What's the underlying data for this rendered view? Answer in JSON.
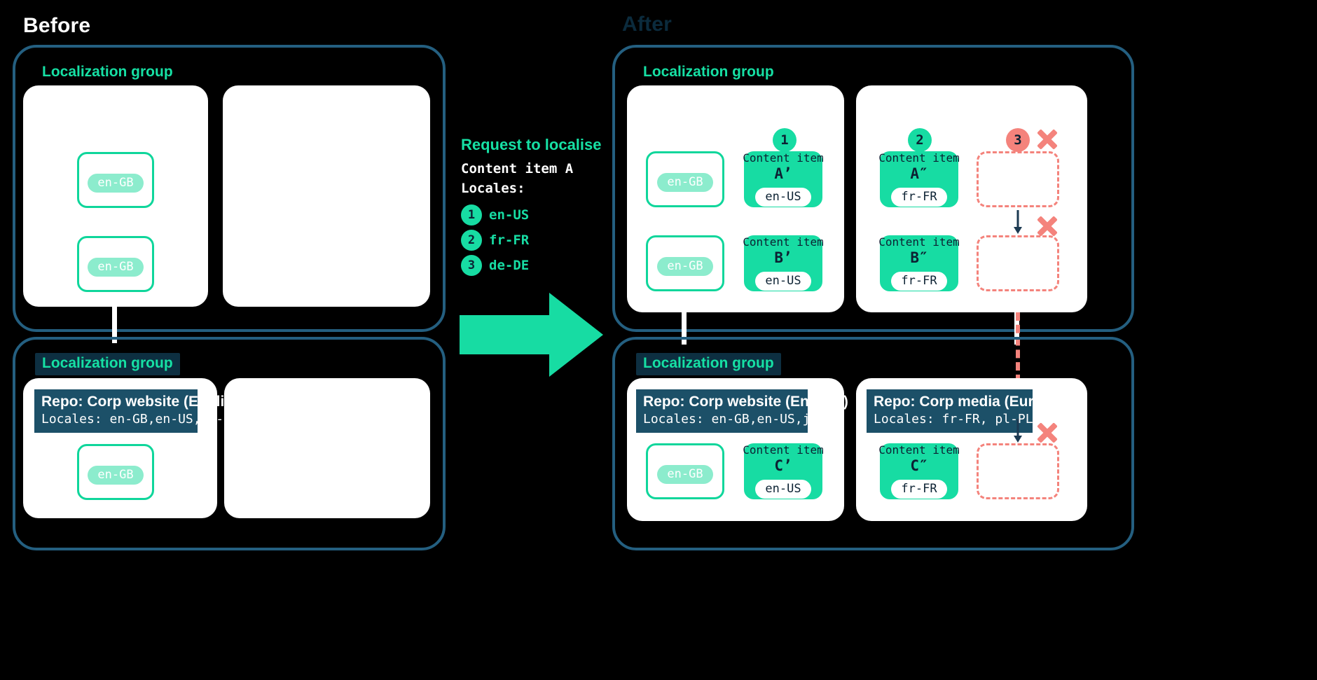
{
  "headings": {
    "before": "Before",
    "after": "After"
  },
  "localization_group_label": "Localization group",
  "request": {
    "title": "Request to localise",
    "line1": "Content item A",
    "line2": "Locales:",
    "items": [
      {
        "num": "1",
        "locale": "en-US"
      },
      {
        "num": "2",
        "locale": "fr-FR"
      },
      {
        "num": "3",
        "locale": "de-DE"
      }
    ]
  },
  "colors": {
    "accent_green": "#17dca3",
    "muted_green": "#8ceccd",
    "dark_blue": "#1c5068",
    "frame_blue": "#245f80",
    "fail_red": "#f4837c",
    "ink": "#0c2233",
    "panel_white": "#ffffff"
  },
  "labels": {
    "content_item": "Content item",
    "locale_en_gb": "en-GB",
    "locale_en_us": "en-US",
    "locale_fr_fr": "fr-FR"
  },
  "repos": {
    "website": {
      "name": "Repo: Corp website (English)",
      "locales": "Locales: en-GB,en-US,jp-JP"
    },
    "media": {
      "name": "Repo: Corp media (Europe)",
      "locales": "Locales: fr-FR, pl-PL"
    }
  },
  "before": {
    "top_group": {
      "label": "Localization group",
      "left_panel": {
        "cards": [
          {
            "locale": "en-GB"
          },
          {
            "locale": "en-GB"
          }
        ]
      },
      "right_panel": {
        "cards": []
      }
    },
    "bottom_group": {
      "label": "Localization group",
      "left_panel": {
        "repo_name": "Repo: Corp website (English)",
        "repo_locales": "Locales: en-GB,en-US,jp-JP",
        "cards": [
          {
            "locale": "en-GB"
          }
        ]
      },
      "right_panel": {
        "cards": []
      }
    }
  },
  "after": {
    "top_group": {
      "label": "Localization group",
      "left_panel": {
        "source_cards": [
          {
            "locale": "en-GB"
          },
          {
            "locale": "en-GB"
          }
        ],
        "localized_cards": [
          {
            "title": "Content item",
            "label": "A’",
            "locale": "en-US",
            "badge": "1"
          },
          {
            "title": "Content item",
            "label": "B’",
            "locale": "en-US",
            "badge": ""
          }
        ]
      },
      "right_panel": {
        "localized_cards": [
          {
            "title": "Content item",
            "label": "A″",
            "locale": "fr-FR",
            "badge": "2"
          },
          {
            "title": "Content item",
            "label": "B″",
            "locale": "fr-FR",
            "badge": ""
          }
        ],
        "failed_cards": [
          {
            "badge": "3",
            "failed": true
          },
          {
            "badge": "",
            "failed": true
          }
        ]
      }
    },
    "bottom_group": {
      "label": "Localization group",
      "left_panel": {
        "repo_name": "Repo: Corp website (English)",
        "repo_locales": "Locales: en-GB,en-US,jp-JP",
        "source_cards": [
          {
            "locale": "en-GB"
          }
        ],
        "localized_cards": [
          {
            "title": "Content item",
            "label": "C’",
            "locale": "en-US"
          }
        ]
      },
      "right_panel": {
        "repo_name": "Repo: Corp media (Europe)",
        "repo_locales": "Locales: fr-FR, pl-PL",
        "localized_cards": [
          {
            "title": "Content item",
            "label": "C″",
            "locale": "fr-FR"
          }
        ],
        "failed_cards": [
          {
            "failed": true
          }
        ]
      }
    }
  }
}
